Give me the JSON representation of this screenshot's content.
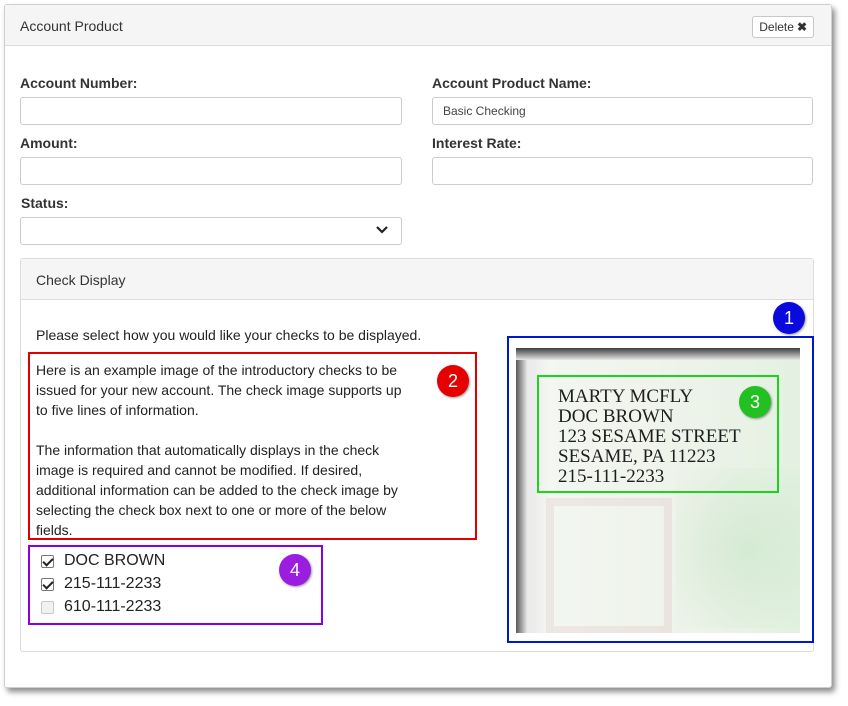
{
  "header": {
    "title": "Account Product",
    "delete_label": "Delete",
    "delete_icon": "✖"
  },
  "fields": {
    "account_number": {
      "label": "Account Number:",
      "value": ""
    },
    "account_product_name": {
      "label": "Account Product Name:",
      "value": "Basic Checking"
    },
    "amount": {
      "label": "Amount:",
      "value": ""
    },
    "interest_rate": {
      "label": "Interest Rate:",
      "value": ""
    },
    "status": {
      "label": "Status:",
      "value": ""
    }
  },
  "check_display": {
    "title": "Check Display",
    "instruction": "Please select how you would like your checks to be displayed.",
    "paragraph1": "Here is an example image of the introductory checks to be issued for your new account. The check image supports up to five lines of information.",
    "paragraph2": "The information that automatically displays in the check image is required and cannot be modified. If desired, additional information can be added to the check image by selecting the check box next to one or more of the below fields.",
    "options": [
      {
        "label": "DOC BROWN",
        "checked": true
      },
      {
        "label": "215-111-2233",
        "checked": true
      },
      {
        "label": "610-111-2233",
        "checked": false
      }
    ],
    "check_image_lines": [
      "MARTY MCFLY",
      "DOC BROWN",
      "123 SESAME STREET",
      "SESAME, PA 11223",
      "215-111-2233"
    ]
  },
  "callouts": {
    "one": {
      "text": "1",
      "color": "#0a0adc"
    },
    "two": {
      "text": "2",
      "color": "#e60000"
    },
    "three": {
      "text": "3",
      "color": "#22c022"
    },
    "four": {
      "text": "4",
      "color": "#9b1de0"
    }
  }
}
